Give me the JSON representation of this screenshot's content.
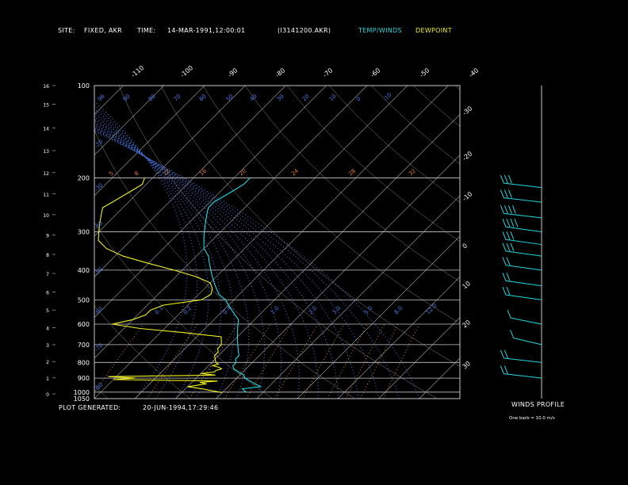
{
  "header": {
    "site_label": "SITE:",
    "site_value": "FIXED, AKR",
    "time_label": "TIME:",
    "time_value": "14-MAR-1991,12:00:01",
    "file_value": "(I3141200.AKR)",
    "legend_temp": "TEMP/WINDS",
    "legend_dew": "DEWPOINT"
  },
  "footer": {
    "generated_label": "PLOT GENERATED:",
    "generated_value": "20-JUN-1994,17:29:46"
  },
  "winds": {
    "title": "WINDS PROFILE",
    "note": "One barb = 10.0 m/s"
  },
  "colors": {
    "temp": "#22d8e0",
    "dew": "#f0f020",
    "frame": "#c8c8c8",
    "isotherm": "#d0d0d0",
    "dry_adiabat": "#f0f0f0",
    "moist_adiabat": "#4a7be8",
    "mixing_ratio": "#e07a3a",
    "pressure_label": "#ffffff",
    "height_label": "#ffffff",
    "moist_label": "#4a7be8",
    "mixing_label": "#e07a3a"
  },
  "chart_data": {
    "type": "line",
    "title": "",
    "pressure_levels": [
      "100",
      "200",
      "300",
      "400",
      "500",
      "600",
      "700",
      "800",
      "900",
      "1000",
      "1050"
    ],
    "height_ticks": [
      "0",
      "1",
      "2",
      "3",
      "4",
      "5",
      "6",
      "7",
      "8",
      "9",
      "10",
      "11",
      "12",
      "13",
      "14",
      "15",
      "16"
    ],
    "top_isotherm_labels": [
      "-110",
      "-100",
      "-90",
      "-80",
      "-70",
      "-60",
      "-50",
      "-40"
    ],
    "right_isotherm_labels": [
      "-30",
      "-20",
      "-10",
      "0",
      "10",
      "20",
      "30"
    ],
    "moist_adiabat_labels_top": [
      "96",
      "90",
      "80",
      "70",
      "60",
      "50",
      "40",
      "30",
      "20",
      "10",
      "0",
      "-10"
    ],
    "moist_adiabat_labels_left": [
      "-20",
      "-30",
      "-40",
      "-50",
      "-60",
      "-70",
      "-80"
    ],
    "mixing_ratio_labels_top": [
      "5",
      "8",
      "12",
      "16",
      "20",
      "24",
      "28",
      "32"
    ],
    "mixing_ratio_labels_mid": [
      "0.1",
      "0.2",
      "0.4",
      "1.0",
      "2.0",
      "3.0",
      "5.0",
      "8.0",
      "12.0"
    ],
    "series": [
      {
        "name": "TEMP/WINDS",
        "points": [
          [
            1003,
            -4
          ],
          [
            990,
            -5
          ],
          [
            975,
            -6
          ],
          [
            960,
            -2
          ],
          [
            940,
            -4
          ],
          [
            920,
            -6
          ],
          [
            900,
            -8
          ],
          [
            880,
            -9
          ],
          [
            860,
            -11
          ],
          [
            840,
            -13
          ],
          [
            820,
            -14
          ],
          [
            800,
            -14
          ],
          [
            780,
            -15
          ],
          [
            760,
            -15
          ],
          [
            740,
            -16
          ],
          [
            720,
            -17
          ],
          [
            700,
            -18
          ],
          [
            680,
            -19
          ],
          [
            660,
            -20
          ],
          [
            640,
            -21
          ],
          [
            620,
            -22
          ],
          [
            600,
            -23
          ],
          [
            580,
            -24
          ],
          [
            560,
            -26
          ],
          [
            540,
            -28
          ],
          [
            520,
            -30
          ],
          [
            500,
            -32
          ],
          [
            480,
            -35
          ],
          [
            460,
            -37
          ],
          [
            440,
            -39
          ],
          [
            420,
            -41
          ],
          [
            400,
            -43
          ],
          [
            380,
            -45
          ],
          [
            360,
            -47
          ],
          [
            340,
            -50
          ],
          [
            320,
            -52
          ],
          [
            300,
            -54
          ],
          [
            280,
            -56
          ],
          [
            260,
            -58
          ],
          [
            250,
            -59
          ],
          [
            240,
            -59
          ],
          [
            230,
            -58
          ],
          [
            220,
            -57
          ],
          [
            210,
            -56
          ],
          [
            200,
            -56
          ]
        ]
      },
      {
        "name": "DEWPOINT",
        "points": [
          [
            1003,
            -10
          ],
          [
            990,
            -13
          ],
          [
            975,
            -16
          ],
          [
            960,
            -20
          ],
          [
            950,
            -18
          ],
          [
            940,
            -16
          ],
          [
            930,
            -18
          ],
          [
            920,
            -14
          ],
          [
            910,
            -40
          ],
          [
            900,
            -35
          ],
          [
            890,
            -42
          ],
          [
            880,
            -16
          ],
          [
            870,
            -20
          ],
          [
            860,
            -17
          ],
          [
            850,
            -17
          ],
          [
            840,
            -16
          ],
          [
            830,
            -17
          ],
          [
            820,
            -19
          ],
          [
            810,
            -18
          ],
          [
            800,
            -19
          ],
          [
            780,
            -20
          ],
          [
            760,
            -21
          ],
          [
            740,
            -21
          ],
          [
            720,
            -22
          ],
          [
            700,
            -22
          ],
          [
            680,
            -23
          ],
          [
            660,
            -24
          ],
          [
            640,
            -34
          ],
          [
            620,
            -46
          ],
          [
            600,
            -54
          ],
          [
            580,
            -50
          ],
          [
            560,
            -48
          ],
          [
            540,
            -48
          ],
          [
            520,
            -46
          ],
          [
            500,
            -38
          ],
          [
            480,
            -37
          ],
          [
            460,
            -38
          ],
          [
            440,
            -40
          ],
          [
            420,
            -45
          ],
          [
            400,
            -52
          ],
          [
            380,
            -60
          ],
          [
            360,
            -68
          ],
          [
            340,
            -74
          ],
          [
            320,
            -78
          ],
          [
            300,
            -80
          ],
          [
            280,
            -82
          ],
          [
            260,
            -84
          ],
          [
            250,
            -85
          ],
          [
            240,
            -84
          ],
          [
            230,
            -83
          ],
          [
            220,
            -82
          ],
          [
            210,
            -81
          ],
          [
            200,
            -82
          ]
        ]
      }
    ],
    "wind_barbs": [
      {
        "pressure": 215,
        "speed": 35,
        "dir": 300
      },
      {
        "pressure": 240,
        "speed": 35,
        "dir": 300
      },
      {
        "pressure": 270,
        "speed": 40,
        "dir": 300
      },
      {
        "pressure": 300,
        "speed": 40,
        "dir": 305
      },
      {
        "pressure": 330,
        "speed": 35,
        "dir": 305
      },
      {
        "pressure": 360,
        "speed": 30,
        "dir": 305
      },
      {
        "pressure": 400,
        "speed": 28,
        "dir": 305
      },
      {
        "pressure": 450,
        "speed": 28,
        "dir": 305
      },
      {
        "pressure": 500,
        "speed": 25,
        "dir": 305
      },
      {
        "pressure": 600,
        "speed": 15,
        "dir": 315
      },
      {
        "pressure": 700,
        "speed": 12,
        "dir": 320
      },
      {
        "pressure": 800,
        "speed": 20,
        "dir": 300
      },
      {
        "pressure": 900,
        "speed": 25,
        "dir": 300
      }
    ],
    "xlim": [
      -40,
      50
    ],
    "ylim": [
      1050,
      100
    ],
    "log_pressure_axis": true
  }
}
